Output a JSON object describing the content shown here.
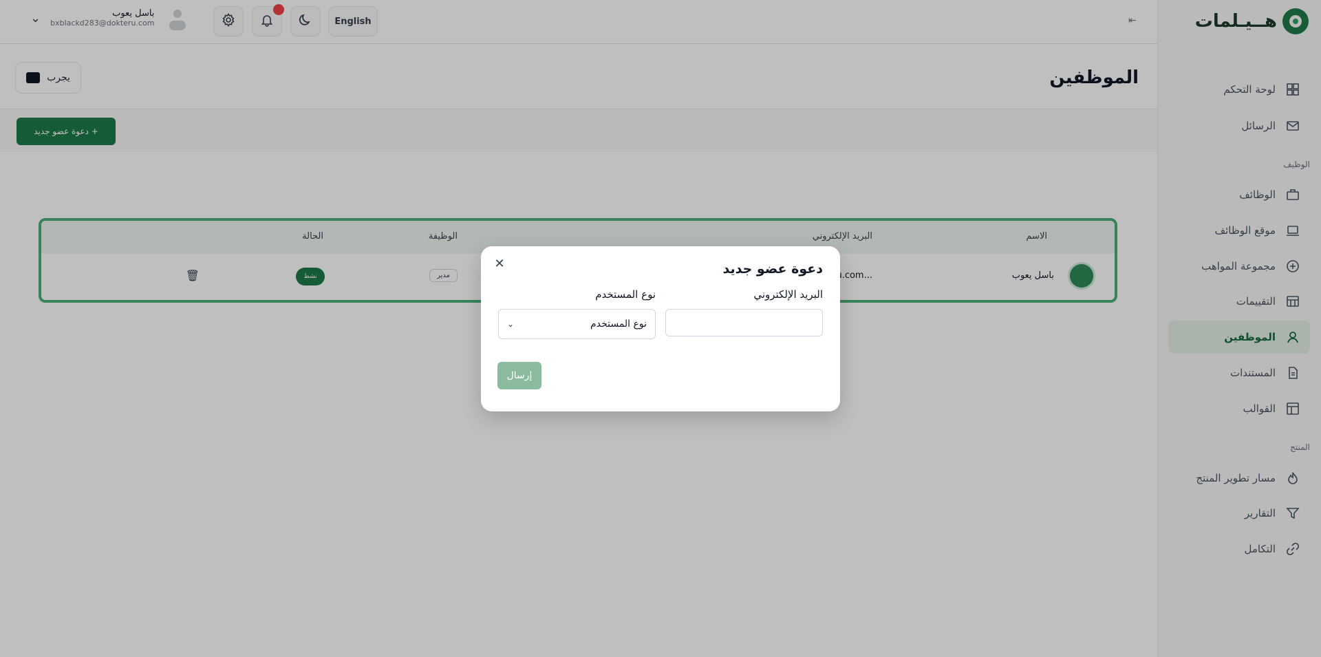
{
  "app": {
    "logo_text": "هــيـلمات",
    "brand_color": "#1d7a47"
  },
  "sidebar": {
    "items_top": [
      {
        "label": "لوحة التحكم",
        "icon": "dashboard-icon"
      },
      {
        "label": "الرسائل",
        "icon": "mail-icon"
      }
    ],
    "section_jobs": "الوظيف",
    "items_jobs": [
      {
        "label": "الوظائف",
        "icon": "briefcase-icon"
      },
      {
        "label": "موقع الوظائف",
        "icon": "laptop-icon"
      },
      {
        "label": "مجموعة المواهب",
        "icon": "talent-icon"
      },
      {
        "label": "التقييمات",
        "icon": "assessment-icon"
      },
      {
        "label": "الموظفين",
        "icon": "user-icon",
        "active": true
      },
      {
        "label": "المستندات",
        "icon": "document-icon"
      },
      {
        "label": "القوالب",
        "icon": "template-icon"
      }
    ],
    "section_product": "المنتج",
    "items_product": [
      {
        "label": "مسار تطوير المنتج",
        "icon": "flame-icon"
      },
      {
        "label": "التقارير",
        "icon": "filter-icon"
      },
      {
        "label": "التكامل",
        "icon": "link-icon"
      }
    ]
  },
  "topbar": {
    "user_name": "باسل يعوب",
    "user_email": "bxblackd283@dokteru.com",
    "language_label": "English",
    "collapse_glyph": "⇤"
  },
  "page": {
    "title": "الموظفين",
    "trial_label": "يجرب",
    "invite_button": "+ دعوة عضو جديد"
  },
  "table": {
    "headers": {
      "name": "الاسم",
      "email": "البريد الإلكتروني",
      "role": "الوظيفة",
      "status": "الحالة"
    },
    "rows": [
      {
        "name": "باسل يعوب",
        "email": "...ru.com",
        "role": "مدير",
        "status": "نشط"
      }
    ]
  },
  "modal": {
    "title": "دعوة عضو جديد",
    "email_label": "البريد الإلكتروني",
    "email_placeholder": "",
    "user_type_label": "نوع المستخدم",
    "user_type_selected": "نوع المستخدم",
    "send_button": "إرسال",
    "close_glyph": "✕"
  }
}
